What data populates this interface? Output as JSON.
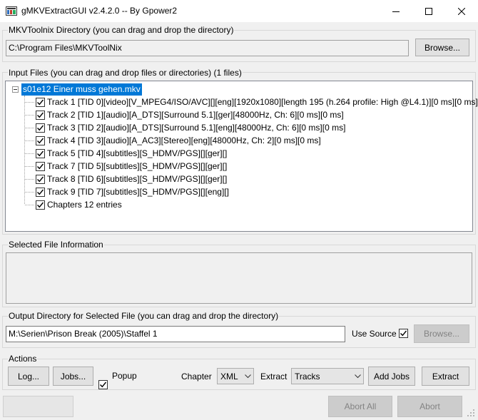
{
  "window": {
    "title": "gMKVExtractGUI v2.4.2.0 -- By Gpower2",
    "icons": [
      "app-icon",
      "minimize-icon",
      "maximize-icon",
      "close-icon"
    ]
  },
  "mkvtoolnix": {
    "group_label": "MKVToolnix Directory (you can drag and drop the directory)",
    "path": "C:\\Program Files\\MKVToolNix",
    "browse_label": "Browse..."
  },
  "input": {
    "group_label": "Input Files (you can drag and drop files or directories) (1 files)",
    "root_file": "s01e12 Einer muss gehen.mkv",
    "items": [
      {
        "label": "Track 1 [TID 0][video][V_MPEG4/ISO/AVC][][eng][1920x1080][length 195 (h.264 profile: High @L4.1)][0 ms][0 ms]",
        "checked": true
      },
      {
        "label": "Track 2 [TID 1][audio][A_DTS][Surround 5.1][ger][48000Hz, Ch: 6][0 ms][0 ms]",
        "checked": true
      },
      {
        "label": "Track 3 [TID 2][audio][A_DTS][Surround 5.1][eng][48000Hz, Ch: 6][0 ms][0 ms]",
        "checked": true
      },
      {
        "label": "Track 4 [TID 3][audio][A_AC3][Stereo][eng][48000Hz, Ch: 2][0 ms][0 ms]",
        "checked": true
      },
      {
        "label": "Track 5 [TID 4][subtitles][S_HDMV/PGS][][ger][]",
        "checked": true
      },
      {
        "label": "Track 7 [TID 5][subtitles][S_HDMV/PGS][][ger][]",
        "checked": true
      },
      {
        "label": "Track 8 [TID 6][subtitles][S_HDMV/PGS][][ger][]",
        "checked": true
      },
      {
        "label": "Track 9 [TID 7][subtitles][S_HDMV/PGS][][eng][]",
        "checked": true
      },
      {
        "label": "Chapters 12 entries",
        "checked": true
      }
    ]
  },
  "info": {
    "group_label": "Selected File Information",
    "text": ""
  },
  "output": {
    "group_label": "Output Directory for Selected File (you can drag and drop the directory)",
    "path": "M:\\Serien\\Prison Break (2005)\\Staffel 1",
    "use_source_label": "Use Source",
    "use_source_checked": true,
    "browse_label": "Browse..."
  },
  "actions": {
    "group_label": "Actions",
    "log_label": "Log...",
    "jobs_label": "Jobs...",
    "popup_label": "Popup",
    "popup_checked": true,
    "chapter_label": "Chapter",
    "chapter_value": "XML",
    "extract_label": "Extract",
    "extract_value": "Tracks",
    "add_jobs_label": "Add Jobs",
    "extract_button_label": "Extract"
  },
  "status": {
    "abort_all_label": "Abort All",
    "abort_label": "Abort"
  }
}
